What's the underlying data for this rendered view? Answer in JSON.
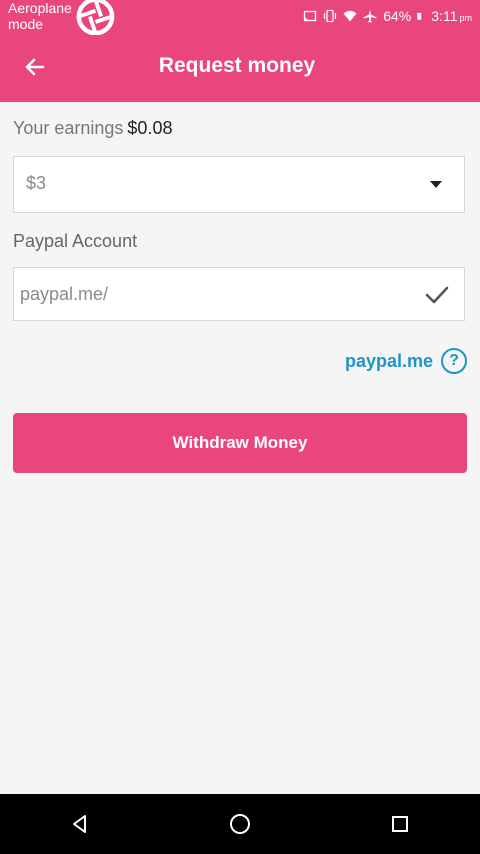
{
  "status_bar": {
    "left_text": "Aeroplane mode",
    "battery": "64%",
    "time": "3:11",
    "ampm": "pm"
  },
  "toolbar": {
    "title": "Request money"
  },
  "earnings": {
    "label": "Your earnings",
    "amount": "$0.08"
  },
  "amount_select": {
    "selected": "$3"
  },
  "paypal": {
    "label": "Paypal Account",
    "placeholder": "paypal.me/",
    "value": "",
    "link_text": "paypal.me",
    "help_symbol": "?"
  },
  "withdraw": {
    "label": "Withdraw Money"
  },
  "colors": {
    "accent": "#e9467b",
    "link": "#1e95c9",
    "background": "#f5f5f5"
  },
  "icons": [
    "arrow-left-icon",
    "chevron-down-icon",
    "checkmark-icon",
    "help-icon",
    "back-nav-icon",
    "home-nav-icon",
    "recents-nav-icon"
  ]
}
